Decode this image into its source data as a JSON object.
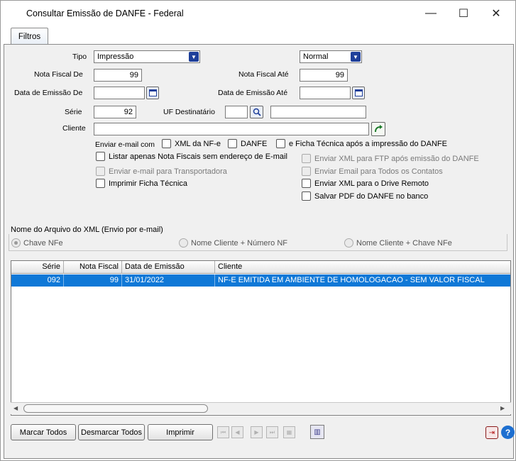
{
  "window": {
    "title": "Consultar Emissão de DANFE - Federal",
    "minimize": "—",
    "maximize": "☐",
    "close": "✕"
  },
  "tabs": [
    {
      "label": "Filtros"
    }
  ],
  "filters": {
    "tipo_label": "Tipo",
    "tipo_value": "Impressão",
    "modo_value": "Normal",
    "nf_de_label": "Nota Fiscal De",
    "nf_de_value": "99",
    "nf_ate_label": "Nota Fiscal Até",
    "nf_ate_value": "99",
    "data_de_label": "Data de Emissão De",
    "data_ate_label": "Data de Emissão Até",
    "serie_label": "Série",
    "serie_value": "92",
    "uf_label": "UF Destinatário",
    "cliente_label": "Cliente"
  },
  "email": {
    "prefix": "Enviar e-mail com",
    "xml_nfe": "XML da NF-e",
    "danfe": "DANFE",
    "ficha": "e Ficha Técnica após a impressão do DANFE"
  },
  "options_left": [
    {
      "label": "Listar apenas Nota Fiscais sem endereço de E-mail",
      "enabled": true
    },
    {
      "label": "Enviar e-mail para Transportadora",
      "enabled": false
    },
    {
      "label": "Imprimir Ficha Técnica",
      "enabled": true
    }
  ],
  "options_right": [
    {
      "label": "Enviar XML para FTP após emissão do DANFE",
      "enabled": false
    },
    {
      "label": "Enviar Email para Todos os Contatos",
      "enabled": false
    },
    {
      "label": "Enviar XML para o Drive Remoto",
      "enabled": true
    },
    {
      "label": "Salvar PDF do DANFE no banco",
      "enabled": true
    }
  ],
  "xml_name": {
    "group_label": "Nome do Arquivo do XML (Envio por e-mail)",
    "opt1": "Chave NFe",
    "opt2": "Nome Cliente + Número NF",
    "opt3": "Nome Cliente + Chave NFe"
  },
  "grid": {
    "headers": [
      "Série",
      "Nota Fiscal",
      "Data de Emissão",
      "Cliente"
    ],
    "rows": [
      {
        "serie": "092",
        "nota": "99",
        "data": "31/01/2022",
        "cliente": "NF-E EMITIDA EM AMBIENTE DE HOMOLOGACAO - SEM VALOR FISCAL"
      }
    ]
  },
  "footer": {
    "marcar": "Marcar Todos",
    "desmarcar": "Desmarcar Todos",
    "imprimir": "Imprimir"
  },
  "icons": {
    "first": "first-record-icon",
    "prev": "previous-record-icon",
    "next": "next-record-icon",
    "last": "last-record-icon",
    "config": "column-config-icon",
    "exit": "exit-icon",
    "help": "help-icon"
  },
  "colors": {
    "accent": "#1e3f9a",
    "selection": "#0f78d7",
    "panel_bg": "#f0f0f0"
  }
}
